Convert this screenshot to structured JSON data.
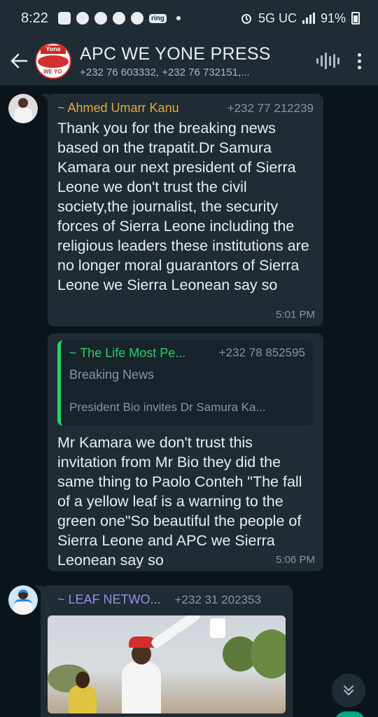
{
  "status_bar": {
    "time": "8:22",
    "notification_icons": [
      "chat-bubble-icon",
      "messenger-icon",
      "facebook-icon",
      "facebook-icon",
      "facebook-icon"
    ],
    "ring_label": "ring",
    "network": "5G UC",
    "battery": "91%"
  },
  "header": {
    "title": "APC WE YONE PRESS",
    "members": "+232 76 603332, +232 76 732151,...",
    "avatar_text_top": "Yone",
    "avatar_text_bottom": "WE YO"
  },
  "messages": [
    {
      "sender": "~ Ahmed Umarr Kanu",
      "sender_color": "#e8a93a",
      "phone": "+232 77 212239",
      "text": "Thank you for the breaking news based on the trapatit.Dr Samura Kamara our next president of Sierra Leone we don't trust the civil society,the journalist, the security forces of Sierra Leone including the religious leaders these institutions are no longer moral guarantors of Sierra Leone we Sierra Leonean say so",
      "time": "5:01 PM"
    },
    {
      "quote": {
        "sender": "~ The Life Most Pe...",
        "phone": "+232 78 852595",
        "title": "Breaking News",
        "body": "President Bio invites Dr Samura Ka..."
      },
      "text": "Mr Kamara we don't trust this invitation from Mr Bio they did the same thing to Paolo Conteh \"The fall of a yellow leaf is a warning to the green one\"So beautiful the people of Sierra Leone and APC we Sierra Leonean say so",
      "time": "5:06 PM"
    },
    {
      "sender": "~ LEAF NETWO...",
      "sender_color": "#9b8cf2",
      "phone": "+232 31 202353"
    }
  ],
  "colors": {
    "chat_background": "#0b141a",
    "bubble": "#1f2c34",
    "quote_accent": "#25d366",
    "fab_green": "#00a884"
  }
}
